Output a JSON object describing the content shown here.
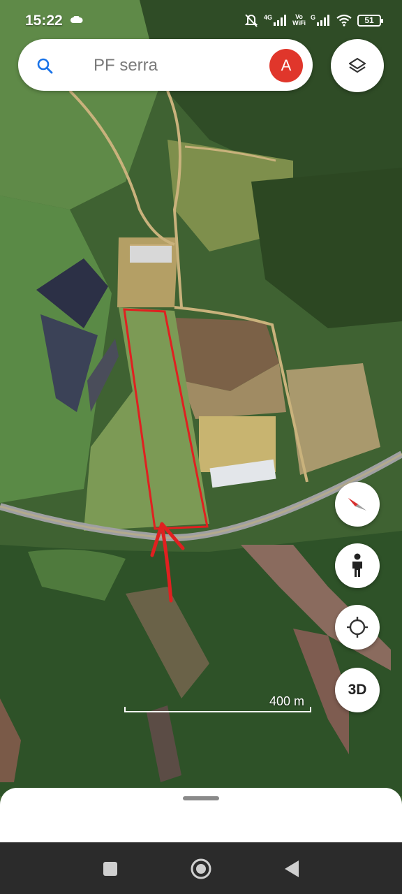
{
  "status_bar": {
    "time": "15:22",
    "network_label": "4G",
    "vowifi_top": "Vo",
    "vowifi_bottom": "WiFi",
    "network2_label": "G",
    "battery": "51"
  },
  "search": {
    "query": "PF serra",
    "avatar_initial": "A"
  },
  "map": {
    "scale_label": "400 m",
    "highlight_color": "#e02020"
  },
  "controls": {
    "three_d_label": "3D"
  },
  "icons": {
    "search": "search-icon",
    "layers": "layers-icon",
    "compass": "compass-icon",
    "street_view": "person-icon",
    "my_location": "crosshair-icon"
  }
}
